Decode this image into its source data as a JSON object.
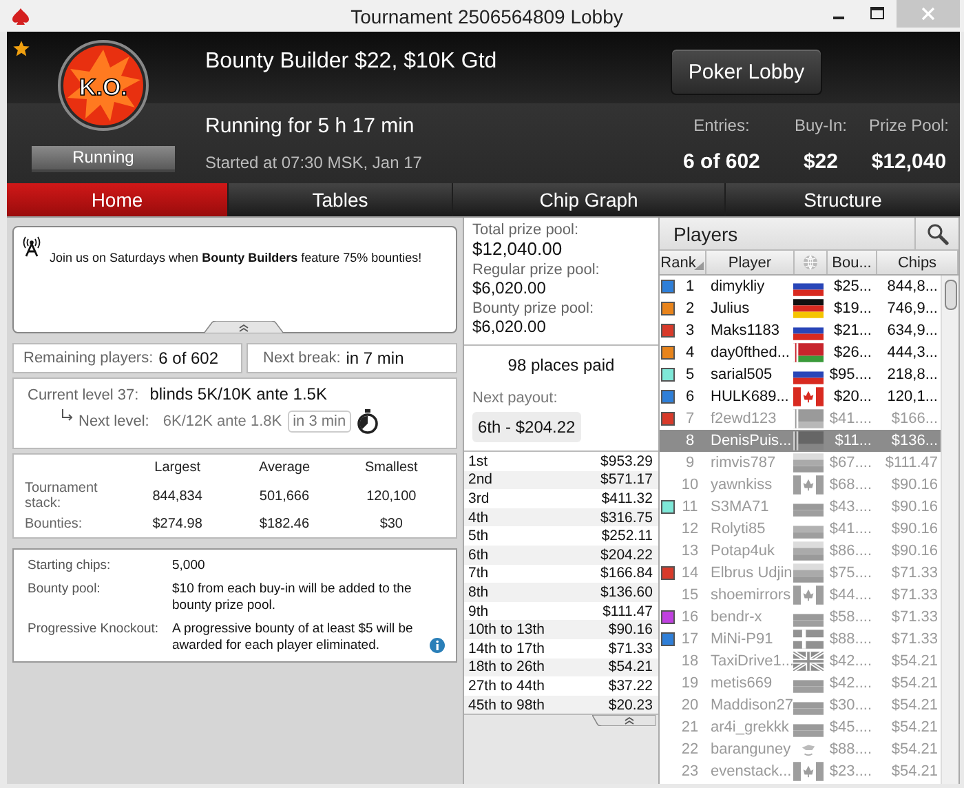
{
  "window": {
    "title": "Tournament 2506564809 Lobby"
  },
  "header": {
    "favorite": true,
    "logo_text": "K.O.",
    "status": "Running",
    "title": "Bounty Builder $22, $10K Gtd",
    "running_for": "Running for 5 h 17 min",
    "started": "Started at 07:30 MSK, Jan 17",
    "lobby_button": "Poker Lobby",
    "stats": [
      {
        "label": "Entries:",
        "value": "6 of 602"
      },
      {
        "label": "Buy-In:",
        "value": "$22"
      },
      {
        "label": "Prize Pool:",
        "value": "$12,040"
      }
    ]
  },
  "tabs": [
    {
      "label": "Home",
      "selected": true
    },
    {
      "label": "Tables",
      "selected": false
    },
    {
      "label": "Chip Graph",
      "selected": false
    },
    {
      "label": "Structure",
      "selected": false
    }
  ],
  "news": {
    "text": "Join us on Saturdays when **Bounty Builders** feature 75% bounties!"
  },
  "remaining": {
    "label": "Remaining players:",
    "value": "6 of 602"
  },
  "next_break": {
    "label": "Next break:",
    "value": "in 7 min"
  },
  "level": {
    "current_label": "Current level 37:",
    "current": "blinds 5K/10K ante 1.5K",
    "next_label": "Next level:",
    "next": "6K/12K ante 1.8K",
    "next_in": "in 3 min"
  },
  "stack_stats": {
    "columns": [
      "Largest",
      "Average",
      "Smallest"
    ],
    "rows": [
      {
        "label": "Tournament stack:",
        "values": [
          "844,834",
          "501,666",
          "120,100"
        ]
      },
      {
        "label": "Bounties:",
        "values": [
          "$274.98",
          "$182.46",
          "$30"
        ]
      }
    ]
  },
  "details": [
    {
      "label": "Starting chips:",
      "value": "5,000",
      "info": false
    },
    {
      "label": "Bounty pool:",
      "value": "$10 from each buy-in will be added to the bounty prize pool.",
      "info": false
    },
    {
      "label": "Progressive Knockout:",
      "value": "A progressive bounty of at least $5 will be awarded for each player eliminated.",
      "info": true
    }
  ],
  "prize_pools": [
    {
      "label": "Total prize pool:",
      "value": "$12,040.00",
      "kind": "total"
    },
    {
      "label": "Regular prize pool:",
      "value": "$6,020.00",
      "kind": "part"
    },
    {
      "label": "Bounty prize pool:",
      "value": "$6,020.00",
      "kind": "part"
    }
  ],
  "places_paid": "98 places paid",
  "next_payout": {
    "label": "Next payout:",
    "value": "6th - $204.22"
  },
  "payouts": [
    {
      "place": "1st",
      "amount": "$953.29"
    },
    {
      "place": "2nd",
      "amount": "$571.17"
    },
    {
      "place": "3rd",
      "amount": "$411.32"
    },
    {
      "place": "4th",
      "amount": "$316.75"
    },
    {
      "place": "5th",
      "amount": "$252.11"
    },
    {
      "place": "6th",
      "amount": "$204.22"
    },
    {
      "place": "7th",
      "amount": "$166.84"
    },
    {
      "place": "8th",
      "amount": "$136.60"
    },
    {
      "place": "9th",
      "amount": "$111.47"
    },
    {
      "place": "10th to 13th",
      "amount": "$90.16"
    },
    {
      "place": "14th to 17th",
      "amount": "$71.33"
    },
    {
      "place": "18th to 26th",
      "amount": "$54.21"
    },
    {
      "place": "27th to 44th",
      "amount": "$37.22"
    },
    {
      "place": "45th to 98th",
      "amount": "$20.23"
    }
  ],
  "players": {
    "title": "Players",
    "columns": [
      "Rank",
      "Player",
      "Bou...",
      "Chips"
    ],
    "rows": [
      {
        "rank": "1",
        "name": "dimykliy",
        "flag": {
          "kind": "ru"
        },
        "bounty": "$25...",
        "chips": "844,8...",
        "color": "#2f7fd8",
        "eliminated": false,
        "selected": false
      },
      {
        "rank": "2",
        "name": "Julius",
        "flag": {
          "kind": "de"
        },
        "bounty": "$19...",
        "chips": "746,9...",
        "color": "#e8841c",
        "eliminated": false,
        "selected": false
      },
      {
        "rank": "3",
        "name": "Maks1183",
        "flag": {
          "kind": "ru"
        },
        "bounty": "$21...",
        "chips": "634,9...",
        "color": "#d83a2a",
        "eliminated": false,
        "selected": false
      },
      {
        "rank": "4",
        "name": "day0fthed...",
        "flag": {
          "kind": "by"
        },
        "bounty": "$26...",
        "chips": "444,3...",
        "color": "#e8841c",
        "eliminated": false,
        "selected": false
      },
      {
        "rank": "5",
        "name": "sarial505",
        "flag": {
          "kind": "ru"
        },
        "bounty": "$95....",
        "chips": "218,8...",
        "color": "#7ee8d8",
        "eliminated": false,
        "selected": false
      },
      {
        "rank": "6",
        "name": "HULK689...",
        "flag": {
          "kind": "ca"
        },
        "bounty": "$20...",
        "chips": "120,1...",
        "color": "#2f7fd8",
        "eliminated": false,
        "selected": false
      },
      {
        "rank": "7",
        "name": "f2ewd123",
        "flag": {
          "kind": "by"
        },
        "bounty": "$41....",
        "chips": "$166...",
        "color": "#d83a2a",
        "eliminated": true,
        "selected": false
      },
      {
        "rank": "8",
        "name": "DenisPuis...",
        "flag": {
          "kind": "by"
        },
        "bounty": "$11...",
        "chips": "$136...",
        "eliminated": true,
        "selected": true
      },
      {
        "rank": "9",
        "name": "rimvis787",
        "flag": {
          "kind": "lt"
        },
        "bounty": "$67....",
        "chips": "$111.47",
        "eliminated": true,
        "selected": false
      },
      {
        "rank": "10",
        "name": "yawnkiss",
        "flag": {
          "kind": "ca"
        },
        "bounty": "$68....",
        "chips": "$90.16",
        "eliminated": true,
        "selected": false
      },
      {
        "rank": "11",
        "name": "S3MA71",
        "flag": {
          "kind": "ru"
        },
        "bounty": "$43....",
        "chips": "$90.16",
        "color": "#7ee8d8",
        "eliminated": true,
        "selected": false
      },
      {
        "rank": "12",
        "name": "Rolyti85",
        "flag": {
          "kind": "bg"
        },
        "bounty": "$41....",
        "chips": "$90.16",
        "eliminated": true,
        "selected": false
      },
      {
        "rank": "13",
        "name": "Potap4uk",
        "flag": {
          "kind": "lt"
        },
        "bounty": "$86....",
        "chips": "$90.16",
        "eliminated": true,
        "selected": false
      },
      {
        "rank": "14",
        "name": "Elbrus Udjin",
        "flag": {
          "kind": "lt"
        },
        "bounty": "$75....",
        "chips": "$71.33",
        "color": "#d83a2a",
        "eliminated": true,
        "selected": false
      },
      {
        "rank": "15",
        "name": "shoemirrors",
        "flag": {
          "kind": "ca"
        },
        "bounty": "$44....",
        "chips": "$71.33",
        "eliminated": true,
        "selected": false
      },
      {
        "rank": "16",
        "name": "bendr-x",
        "flag": {
          "kind": "ru"
        },
        "bounty": "$58....",
        "chips": "$71.33",
        "color": "#c040e0",
        "eliminated": true,
        "selected": false
      },
      {
        "rank": "17",
        "name": "MiNi-P91",
        "flag": {
          "kind": "dk"
        },
        "bounty": "$88....",
        "chips": "$71.33",
        "color": "#2f7fd8",
        "eliminated": true,
        "selected": false
      },
      {
        "rank": "18",
        "name": "TaxiDrive1...",
        "flag": {
          "kind": "gb"
        },
        "bounty": "$42....",
        "chips": "$54.21",
        "eliminated": true,
        "selected": false
      },
      {
        "rank": "19",
        "name": "metis669",
        "flag": {
          "kind": "ru"
        },
        "bounty": "$42....",
        "chips": "$54.21",
        "eliminated": true,
        "selected": false
      },
      {
        "rank": "20",
        "name": "Maddison27",
        "flag": {
          "kind": "ru"
        },
        "bounty": "$30....",
        "chips": "$54.21",
        "eliminated": true,
        "selected": false
      },
      {
        "rank": "21",
        "name": "ar4i_grekkk",
        "flag": {
          "kind": "ru"
        },
        "bounty": "$45....",
        "chips": "$54.21",
        "eliminated": true,
        "selected": false
      },
      {
        "rank": "22",
        "name": "baranguney",
        "flag": {
          "kind": "cy"
        },
        "bounty": "$88....",
        "chips": "$54.21",
        "eliminated": true,
        "selected": false
      },
      {
        "rank": "23",
        "name": "evenstack...",
        "flag": {
          "kind": "ca"
        },
        "bounty": "$23....",
        "chips": "$54.21",
        "eliminated": true,
        "selected": false
      }
    ]
  }
}
